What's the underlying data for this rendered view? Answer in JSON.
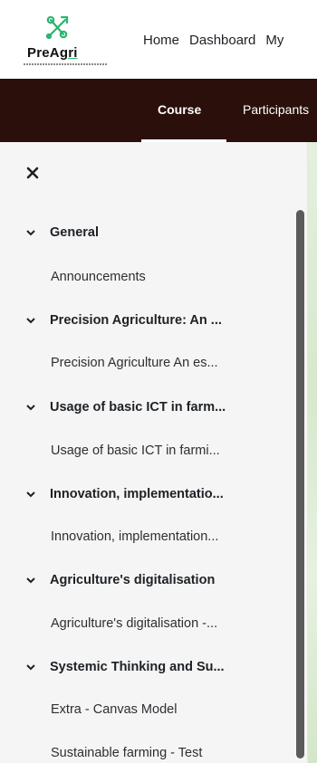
{
  "brand": {
    "name_prefix": "PreA",
    "name_suffix": "gri",
    "logo_icon": "preagri-logo-icon",
    "accent": "#29b46e"
  },
  "nav": {
    "links": [
      "Home",
      "Dashboard",
      "My"
    ]
  },
  "course_nav": {
    "background": "#2a0f0a",
    "tabs": [
      "Course",
      "Participants"
    ],
    "active_tab": "Course"
  },
  "drawer": {
    "close_icon": "close-icon",
    "sections": [
      {
        "title": "General",
        "activities": [
          "Announcements"
        ]
      },
      {
        "title": "Precision Agriculture: An ...",
        "activities": [
          "Precision Agriculture An es..."
        ]
      },
      {
        "title": "Usage of basic ICT in farm...",
        "activities": [
          "Usage of basic ICT in farmi..."
        ]
      },
      {
        "title": "Innovation, implementatio...",
        "activities": [
          "Innovation, implementation..."
        ]
      },
      {
        "title": "Agriculture's digitalisation",
        "activities": [
          "Agriculture's digitalisation -..."
        ]
      },
      {
        "title": "Systemic Thinking and Su...",
        "activities": [
          "Extra - Canvas Model",
          "Sustainable farming - Test"
        ]
      }
    ]
  }
}
